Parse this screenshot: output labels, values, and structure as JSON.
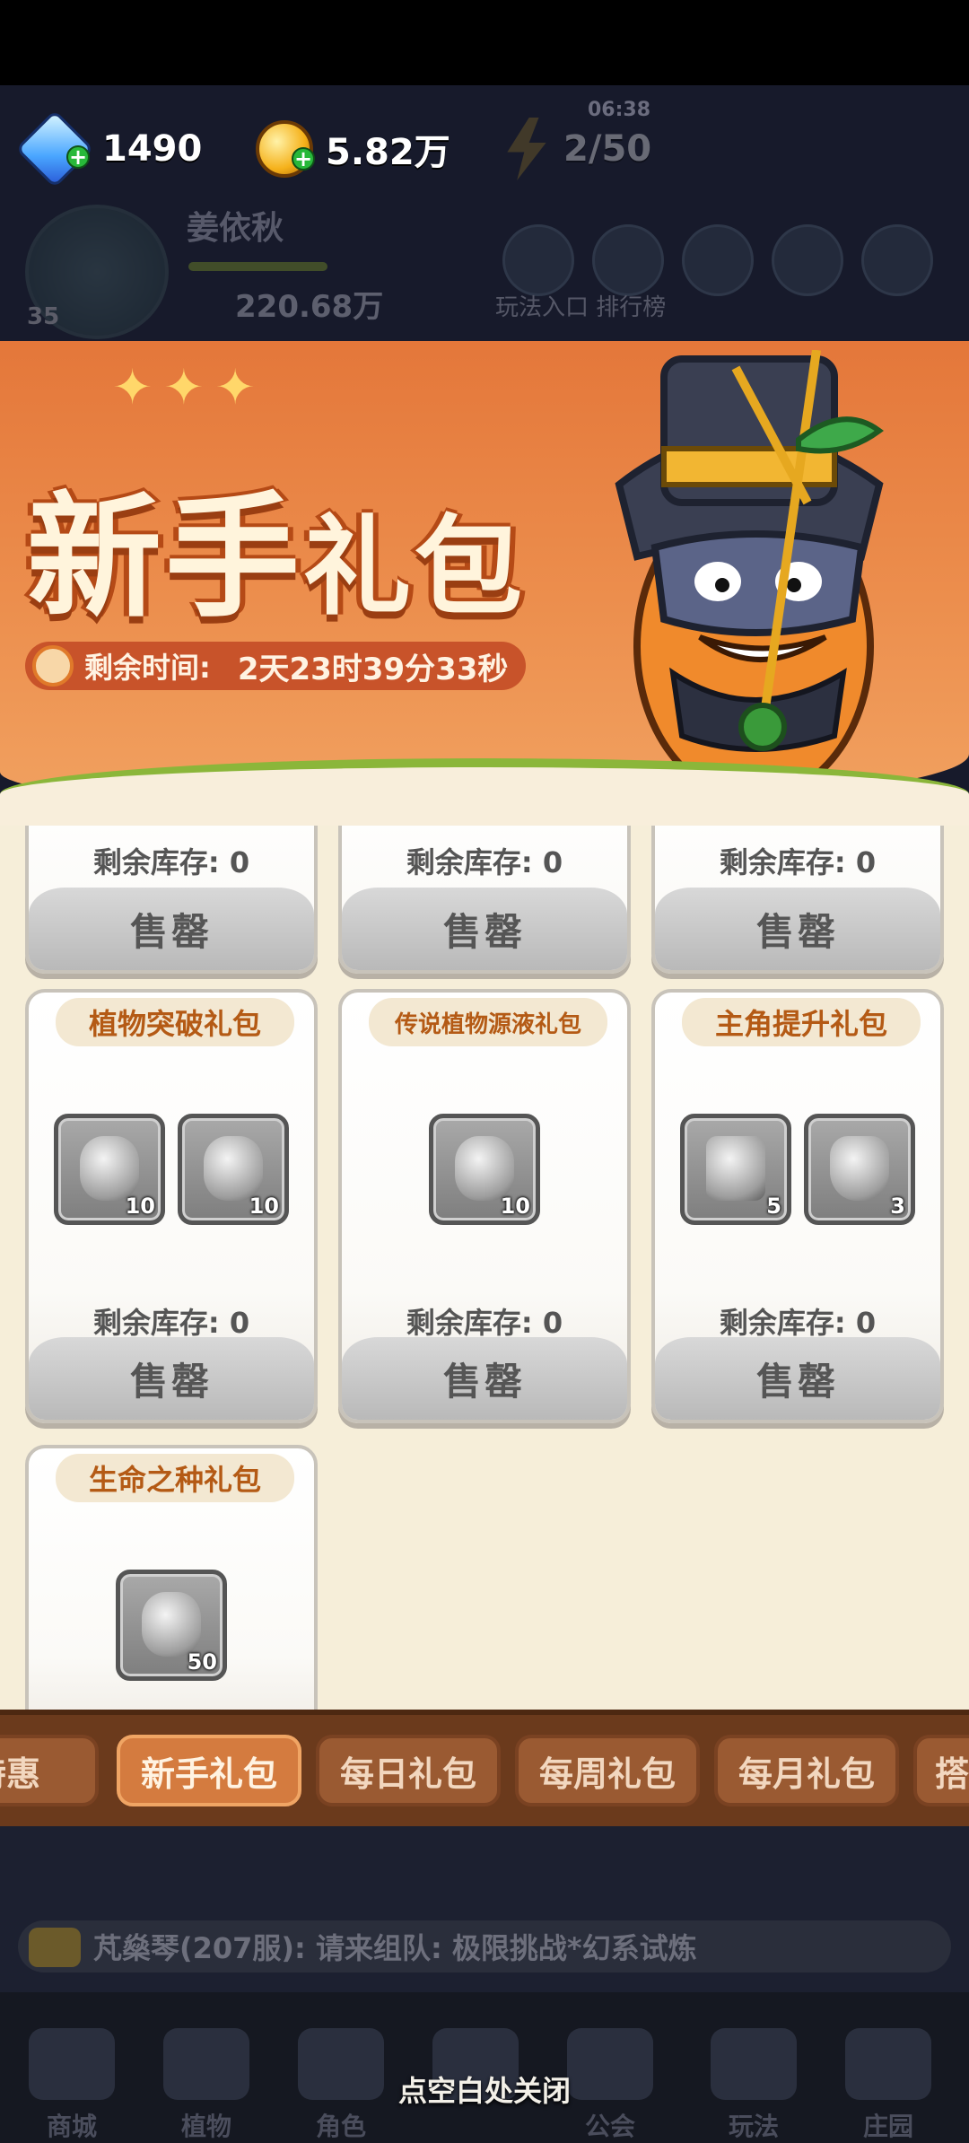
{
  "currency": {
    "gems": "1490",
    "gold": "5.82万",
    "energy": "2/50",
    "energy_timer": "06:38"
  },
  "player": {
    "name": "姜依秋",
    "level": "35",
    "power": "220.68万",
    "hud_label": "玩法入口 排行榜"
  },
  "banner": {
    "title_a": "新手",
    "title_b": "礼包",
    "time_label": "剩余时间:",
    "time_value": "2天23时39分33秒"
  },
  "top_cards": [
    {
      "stock": "剩余库存: 0",
      "status": "售罄"
    },
    {
      "stock": "剩余库存: 0",
      "status": "售罄"
    },
    {
      "stock": "剩余库存: 0",
      "status": "售罄"
    }
  ],
  "cards": [
    {
      "title": "植物突破礼包",
      "items": [
        {
          "name": "potion-icon",
          "qty": "10"
        },
        {
          "name": "potion-icon",
          "qty": "10"
        }
      ],
      "stock": "剩余库存: 0",
      "status": "售罄"
    },
    {
      "title": "传说植物源液礼包",
      "items": [
        {
          "name": "potion-icon",
          "qty": "10"
        }
      ],
      "stock": "剩余库存: 0",
      "status": "售罄"
    },
    {
      "title": "主角提升礼包",
      "items": [
        {
          "name": "scroll-icon",
          "qty": "5"
        },
        {
          "name": "bottle-icon",
          "qty": "3"
        }
      ],
      "stock": "剩余库存: 0",
      "status": "售罄"
    },
    {
      "title": "生命之种礼包",
      "items": [
        {
          "name": "seed-icon",
          "qty": "50"
        }
      ]
    }
  ],
  "tabs": [
    "特惠",
    "新手礼包",
    "每日礼包",
    "每周礼包",
    "每月礼包",
    "搭"
  ],
  "active_tab": "新手礼包",
  "chat": "芃燊琴(207服): 请来组队: 极限挑战*幻系试炼",
  "nav": [
    "商城",
    "植物",
    "角色",
    "",
    "公会",
    "玩法",
    "庄园"
  ],
  "close_hint": "点空白处关闭"
}
